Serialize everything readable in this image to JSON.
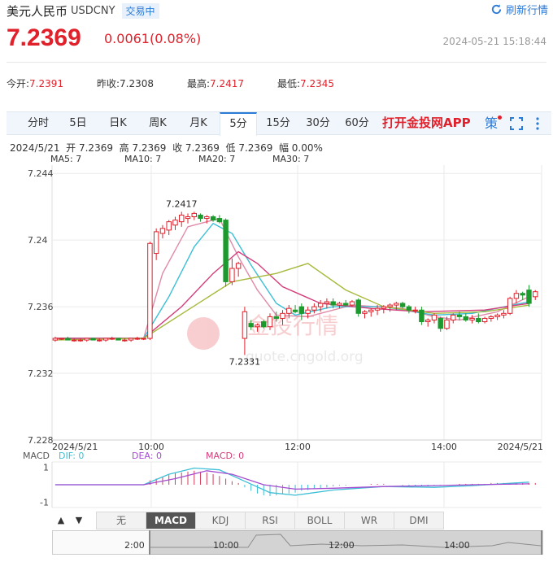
{
  "header": {
    "name": "美元人民币",
    "code": "USDCNY",
    "status": "交易中",
    "refresh_label": "刷新行情",
    "price": "7.2369",
    "change": "0.0061(0.08%)",
    "timestamp": "2024-05-21 15:18:44"
  },
  "quotes": [
    {
      "label": "今开:",
      "value": "7.2391"
    },
    {
      "label": "昨收:",
      "value": "7.2308"
    },
    {
      "label": "最高:",
      "value": "7.2417"
    },
    {
      "label": "最低:",
      "value": "7.2345"
    }
  ],
  "period_tabs": [
    "分时",
    "5日",
    "日K",
    "周K",
    "月K",
    "5分",
    "15分",
    "30分",
    "60分"
  ],
  "active_period": "5分",
  "app_link": "打开金投网APP",
  "strategy_label": "策",
  "watermark": {
    "brand": "金投行情",
    "url": "quote.cngold.org"
  },
  "info_bar": {
    "date": "2024/5/21",
    "open": "开 7.2369",
    "high": "高 7.2369",
    "close": "收 7.2369",
    "low": "低 7.2369",
    "amp": "幅 0.00%"
  },
  "ma_labels": [
    {
      "label": "MA5: 7",
      "color": "#e08aa8"
    },
    {
      "label": "MA10: 7",
      "color": "#3bbfd6"
    },
    {
      "label": "MA20: 7",
      "color": "#d43c7a"
    },
    {
      "label": "MA30: 7",
      "color": "#a7b93c"
    }
  ],
  "macd_labels": {
    "name": "MACD",
    "dif": "DIF: 0",
    "dea": "DEA: 0",
    "macd": "MACD: 0"
  },
  "indicator_tabs": [
    "无",
    "MACD",
    "KDJ",
    "RSI",
    "BOLL",
    "WR",
    "DMI"
  ],
  "active_indicator": "MACD",
  "navigator_labels": [
    "2:00",
    "10:00",
    "12:00",
    "14:00"
  ],
  "colors": {
    "up": "#e0202a",
    "down": "#1c9a2e",
    "accent": "#2a7ad6"
  },
  "chart_data": {
    "type": "candlestick",
    "ylim": [
      7.228,
      7.2445
    ],
    "y_ticks": [
      7.244,
      7.24,
      7.236,
      7.232,
      7.228
    ],
    "x_ticks": [
      "2024/5/21",
      "10:00",
      "12:00",
      "14:00",
      "2024/5/21"
    ],
    "annotations": [
      {
        "label": "7.2417",
        "value": 7.2417
      },
      {
        "label": "7.2331",
        "value": 7.2331
      }
    ],
    "candles": [
      [
        7.234,
        7.2342,
        7.2339,
        7.2341
      ],
      [
        7.2341,
        7.2341,
        7.234,
        7.2341
      ],
      [
        7.2341,
        7.2342,
        7.234,
        7.234
      ],
      [
        7.234,
        7.2341,
        7.2339,
        7.234
      ],
      [
        7.234,
        7.2341,
        7.2339,
        7.234
      ],
      [
        7.234,
        7.2341,
        7.2339,
        7.2341
      ],
      [
        7.2341,
        7.2341,
        7.234,
        7.234
      ],
      [
        7.234,
        7.2341,
        7.2339,
        7.234
      ],
      [
        7.234,
        7.2341,
        7.2339,
        7.2341
      ],
      [
        7.2341,
        7.2342,
        7.234,
        7.2341
      ],
      [
        7.2341,
        7.2341,
        7.234,
        7.234
      ],
      [
        7.234,
        7.2341,
        7.2339,
        7.234
      ],
      [
        7.234,
        7.2341,
        7.2339,
        7.2341
      ],
      [
        7.2341,
        7.2342,
        7.234,
        7.2341
      ],
      [
        7.2341,
        7.2341,
        7.234,
        7.2341
      ],
      [
        7.2341,
        7.2399,
        7.234,
        7.2398
      ],
      [
        7.2392,
        7.2407,
        7.2388,
        7.2405
      ],
      [
        7.2404,
        7.2409,
        7.2401,
        7.2407
      ],
      [
        7.2406,
        7.2412,
        7.2403,
        7.2411
      ],
      [
        7.2409,
        7.2414,
        7.2406,
        7.2412
      ],
      [
        7.2411,
        7.2417,
        7.2408,
        7.2415
      ],
      [
        7.2413,
        7.2416,
        7.241,
        7.2414
      ],
      [
        7.2414,
        7.2417,
        7.2412,
        7.2416
      ],
      [
        7.2415,
        7.2416,
        7.2411,
        7.2413
      ],
      [
        7.2413,
        7.2415,
        7.241,
        7.2414
      ],
      [
        7.2414,
        7.2415,
        7.2411,
        7.2412
      ],
      [
        7.2413,
        7.2415,
        7.241,
        7.2411
      ],
      [
        7.2412,
        7.2413,
        7.2372,
        7.2375
      ],
      [
        7.2375,
        7.2389,
        7.2373,
        7.2383
      ],
      [
        7.2383,
        7.2387,
        7.2378,
        7.2386
      ],
      [
        7.2341,
        7.236,
        7.2331,
        7.2357
      ],
      [
        7.235,
        7.2352,
        7.2346,
        7.2348
      ],
      [
        7.2348,
        7.235,
        7.2345,
        7.2349
      ],
      [
        7.2351,
        7.2352,
        7.2347,
        7.2348
      ],
      [
        7.2348,
        7.2356,
        7.2346,
        7.2354
      ],
      [
        7.2354,
        7.2357,
        7.2351,
        7.2353
      ],
      [
        7.2353,
        7.2358,
        7.2349,
        7.2356
      ],
      [
        7.2356,
        7.2361,
        7.2353,
        7.2359
      ],
      [
        7.2358,
        7.2361,
        7.2356,
        7.2357
      ],
      [
        7.236,
        7.2362,
        7.2352,
        7.2356
      ],
      [
        7.2356,
        7.236,
        7.2353,
        7.2358
      ],
      [
        7.2358,
        7.2362,
        7.2356,
        7.236
      ],
      [
        7.236,
        7.2364,
        7.2357,
        7.2362
      ],
      [
        7.2362,
        7.2365,
        7.2359,
        7.2363
      ],
      [
        7.2363,
        7.2365,
        7.2359,
        7.2361
      ],
      [
        7.2361,
        7.2363,
        7.2359,
        7.2362
      ],
      [
        7.2362,
        7.2364,
        7.236,
        7.2361
      ],
      [
        7.2361,
        7.2364,
        7.236,
        7.2363
      ],
      [
        7.2364,
        7.2365,
        7.2354,
        7.2356
      ],
      [
        7.2356,
        7.2358,
        7.2353,
        7.2357
      ],
      [
        7.2357,
        7.2359,
        7.2354,
        7.2358
      ],
      [
        7.2358,
        7.2361,
        7.2355,
        7.2359
      ],
      [
        7.2359,
        7.2361,
        7.2356,
        7.236
      ],
      [
        7.236,
        7.2362,
        7.2357,
        7.2361
      ],
      [
        7.2361,
        7.2363,
        7.2358,
        7.2362
      ],
      [
        7.2362,
        7.2363,
        7.2359,
        7.236
      ],
      [
        7.236,
        7.2361,
        7.2356,
        7.2358
      ],
      [
        7.2358,
        7.236,
        7.2356,
        7.2358
      ],
      [
        7.2358,
        7.236,
        7.2349,
        7.2351
      ],
      [
        7.2351,
        7.2353,
        7.2348,
        7.2352
      ],
      [
        7.2352,
        7.2356,
        7.235,
        7.2355
      ],
      [
        7.2353,
        7.2354,
        7.2345,
        7.2347
      ],
      [
        7.2347,
        7.2354,
        7.2346,
        7.2352
      ],
      [
        7.2352,
        7.2356,
        7.235,
        7.2355
      ],
      [
        7.2355,
        7.2357,
        7.2352,
        7.2354
      ],
      [
        7.2354,
        7.2356,
        7.2351,
        7.2352
      ],
      [
        7.2352,
        7.2355,
        7.235,
        7.2353
      ],
      [
        7.2353,
        7.2356,
        7.235,
        7.2351
      ],
      [
        7.2351,
        7.2354,
        7.235,
        7.2353
      ],
      [
        7.2353,
        7.2355,
        7.2351,
        7.2354
      ],
      [
        7.2354,
        7.2356,
        7.2352,
        7.2355
      ],
      [
        7.2355,
        7.2358,
        7.2353,
        7.2356
      ],
      [
        7.2356,
        7.2366,
        7.2355,
        7.2365
      ],
      [
        7.2365,
        7.237,
        7.2362,
        7.2368
      ],
      [
        7.2368,
        7.2369,
        7.2364,
        7.2367
      ],
      [
        7.237,
        7.2373,
        7.236,
        7.2362
      ],
      [
        7.2366,
        7.237,
        7.2364,
        7.2369
      ]
    ],
    "ma_series": [
      {
        "name": "MA5",
        "color": "#e08aa8",
        "points": [
          [
            0,
            7.2341
          ],
          [
            14,
            7.2341
          ],
          [
            17,
            7.238
          ],
          [
            21,
            7.2408
          ],
          [
            26,
            7.2413
          ],
          [
            29,
            7.239
          ],
          [
            32,
            7.237
          ],
          [
            35,
            7.2355
          ],
          [
            40,
            7.2354
          ],
          [
            47,
            7.2361
          ],
          [
            55,
            7.2359
          ],
          [
            60,
            7.2354
          ],
          [
            64,
            7.2352
          ],
          [
            70,
            7.2357
          ],
          [
            75,
            7.2366
          ]
        ]
      },
      {
        "name": "MA10",
        "color": "#3bbfd6",
        "points": [
          [
            0,
            7.2341
          ],
          [
            14,
            7.2341
          ],
          [
            18,
            7.2366
          ],
          [
            22,
            7.2396
          ],
          [
            25,
            7.241
          ],
          [
            28,
            7.2404
          ],
          [
            31,
            7.2385
          ],
          [
            35,
            7.2362
          ],
          [
            38,
            7.2355
          ],
          [
            44,
            7.236
          ],
          [
            52,
            7.236
          ],
          [
            60,
            7.2355
          ],
          [
            66,
            7.2356
          ],
          [
            75,
            7.2363
          ]
        ]
      },
      {
        "name": "MA20",
        "color": "#d43c7a",
        "points": [
          [
            0,
            7.2341
          ],
          [
            14,
            7.2341
          ],
          [
            20,
            7.236
          ],
          [
            25,
            7.238
          ],
          [
            29,
            7.2393
          ],
          [
            32,
            7.2386
          ],
          [
            36,
            7.2372
          ],
          [
            42,
            7.2362
          ],
          [
            50,
            7.2359
          ],
          [
            58,
            7.2357
          ],
          [
            68,
            7.2358
          ],
          [
            75,
            7.2362
          ]
        ]
      },
      {
        "name": "MA30",
        "color": "#a7b93c",
        "points": [
          [
            0,
            7.234
          ],
          [
            14,
            7.2341
          ],
          [
            21,
            7.2358
          ],
          [
            28,
            7.2375
          ],
          [
            35,
            7.238
          ],
          [
            40,
            7.2386
          ],
          [
            46,
            7.237
          ],
          [
            52,
            7.236
          ],
          [
            60,
            7.2356
          ],
          [
            68,
            7.2357
          ],
          [
            75,
            7.2361
          ]
        ]
      }
    ],
    "macd": {
      "ylim": [
        -1.3,
        1.3
      ],
      "y_ticks": [
        1,
        -1
      ],
      "dif": [
        [
          0,
          0
        ],
        [
          14,
          0
        ],
        [
          18,
          0.6
        ],
        [
          22,
          0.95
        ],
        [
          26,
          0.85
        ],
        [
          30,
          0.2
        ],
        [
          34,
          -0.45
        ],
        [
          38,
          -0.6
        ],
        [
          44,
          -0.3
        ],
        [
          52,
          -0.1
        ],
        [
          60,
          -0.15
        ],
        [
          66,
          -0.05
        ],
        [
          75,
          0.15
        ]
      ],
      "dea": [
        [
          0,
          0
        ],
        [
          14,
          0
        ],
        [
          19,
          0.35
        ],
        [
          24,
          0.8
        ],
        [
          28,
          0.6
        ],
        [
          33,
          0.0
        ],
        [
          38,
          -0.25
        ],
        [
          44,
          -0.2
        ],
        [
          52,
          -0.1
        ],
        [
          60,
          -0.05
        ],
        [
          66,
          0.0
        ],
        [
          75,
          0.05
        ]
      ],
      "hist": [
        0,
        0,
        0,
        0,
        0,
        0,
        0,
        0,
        0,
        0,
        0,
        0,
        0,
        0,
        0,
        0.25,
        0.35,
        0.45,
        0.55,
        0.65,
        0.7,
        0.75,
        0.8,
        0.75,
        0.7,
        0.6,
        0.5,
        0.35,
        0.2,
        0.1,
        -0.15,
        -0.35,
        -0.5,
        -0.6,
        -0.65,
        -0.6,
        -0.55,
        -0.5,
        -0.45,
        -0.35,
        -0.3,
        -0.25,
        -0.2,
        -0.15,
        -0.1,
        -0.05,
        -0.05,
        0,
        0,
        0,
        0.05,
        0.05,
        0.05,
        0,
        0,
        -0.05,
        -0.05,
        -0.05,
        -0.1,
        -0.1,
        -0.05,
        -0.05,
        0,
        0,
        0.05,
        0.05,
        0.05,
        0.05,
        0.05,
        0.1,
        0.1,
        0.1,
        0.1,
        0.1,
        0.1,
        0.1,
        0.1
      ]
    }
  }
}
